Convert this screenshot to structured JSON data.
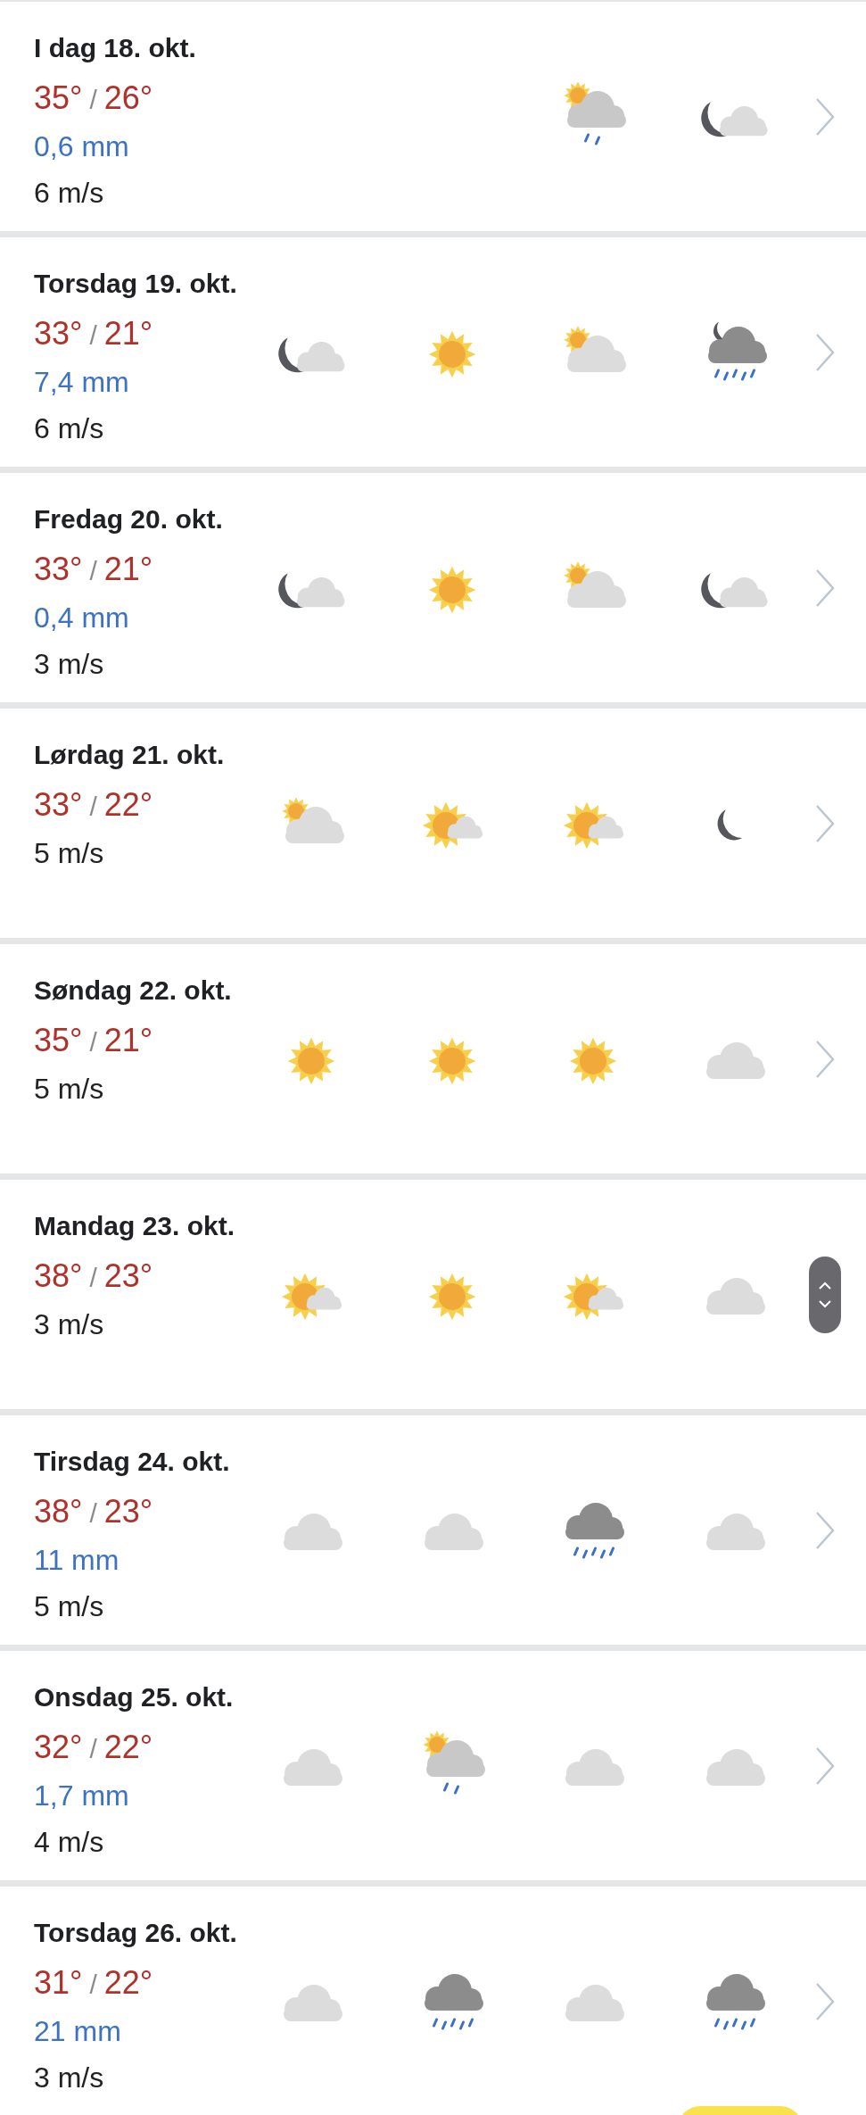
{
  "days": [
    {
      "title": "I dag 18. okt.",
      "high": "35°",
      "sep": "/",
      "low": "26°",
      "precip": "0,6 mm",
      "wind": "6 m/s",
      "icons": [
        {
          "kind": "sun-cloud-rain"
        },
        {
          "kind": "moon-cloud"
        }
      ],
      "scroll_handle": false
    },
    {
      "title": "Torsdag 19. okt.",
      "high": "33°",
      "sep": "/",
      "low": "21°",
      "precip": "7,4 mm",
      "wind": "6 m/s",
      "icons": [
        {
          "kind": "moon-cloud"
        },
        {
          "kind": "sun"
        },
        {
          "kind": "sun-cloud"
        },
        {
          "kind": "moon-cloud-rain"
        }
      ],
      "scroll_handle": false
    },
    {
      "title": "Fredag 20. okt.",
      "high": "33°",
      "sep": "/",
      "low": "21°",
      "precip": "0,4 mm",
      "wind": "3 m/s",
      "icons": [
        {
          "kind": "moon-cloud"
        },
        {
          "kind": "sun"
        },
        {
          "kind": "sun-cloud"
        },
        {
          "kind": "moon-cloud"
        }
      ],
      "scroll_handle": false
    },
    {
      "title": "Lørdag 21. okt.",
      "high": "33°",
      "sep": "/",
      "low": "22°",
      "wind": "5 m/s",
      "icons": [
        {
          "kind": "sun-cloud"
        },
        {
          "kind": "sun-small-cloud"
        },
        {
          "kind": "sun-small-cloud"
        },
        {
          "kind": "moon"
        }
      ],
      "scroll_handle": false
    },
    {
      "title": "Søndag 22. okt.",
      "high": "35°",
      "sep": "/",
      "low": "21°",
      "wind": "5 m/s",
      "icons": [
        {
          "kind": "sun"
        },
        {
          "kind": "sun"
        },
        {
          "kind": "sun"
        },
        {
          "kind": "cloud"
        }
      ],
      "scroll_handle": false
    },
    {
      "title": "Mandag 23. okt.",
      "high": "38°",
      "sep": "/",
      "low": "23°",
      "wind": "3 m/s",
      "icons": [
        {
          "kind": "sun-small-cloud"
        },
        {
          "kind": "sun"
        },
        {
          "kind": "sun-small-cloud"
        },
        {
          "kind": "cloud"
        }
      ],
      "scroll_handle": true
    },
    {
      "title": "Tirsdag 24. okt.",
      "high": "38°",
      "sep": "/",
      "low": "23°",
      "precip": "11 mm",
      "wind": "5 m/s",
      "icons": [
        {
          "kind": "cloud"
        },
        {
          "kind": "cloud"
        },
        {
          "kind": "rain-cloud"
        },
        {
          "kind": "cloud"
        }
      ],
      "scroll_handle": false
    },
    {
      "title": "Onsdag 25. okt.",
      "high": "32°",
      "sep": "/",
      "low": "22°",
      "precip": "1,7 mm",
      "wind": "4 m/s",
      "icons": [
        {
          "kind": "cloud"
        },
        {
          "kind": "sun-cloud-rain"
        },
        {
          "kind": "cloud"
        },
        {
          "kind": "cloud"
        }
      ],
      "scroll_handle": false
    },
    {
      "title": "Torsdag 26. okt.",
      "high": "31°",
      "sep": "/",
      "low": "22°",
      "precip": "21 mm",
      "wind": "3 m/s",
      "icons": [
        {
          "kind": "cloud"
        },
        {
          "kind": "rain-cloud"
        },
        {
          "kind": "cloud"
        },
        {
          "kind": "rain-cloud"
        }
      ],
      "scroll_handle": false
    }
  ]
}
